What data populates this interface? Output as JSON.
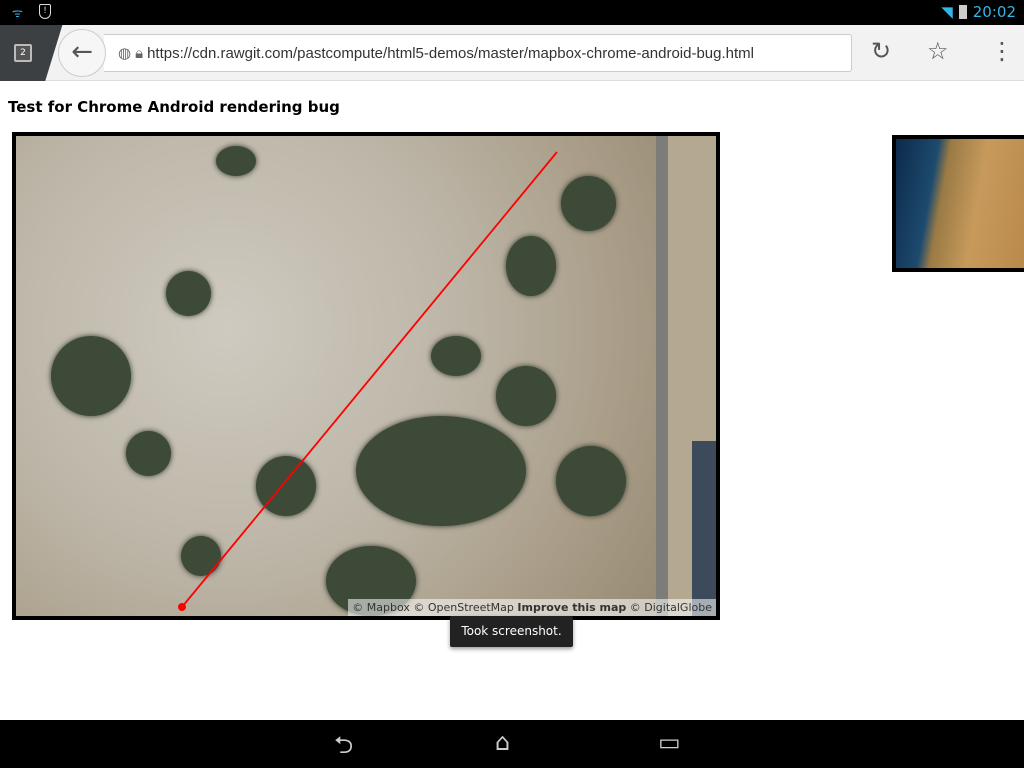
{
  "status_bar": {
    "time": "20:02",
    "icons": [
      "wifi-icon",
      "shield-alert-icon",
      "wifi-signal-icon",
      "battery-icon"
    ]
  },
  "browser": {
    "tab_count": "2",
    "url": "https://cdn.rawgit.com/pastcompute/html5-demos/master/mapbox-chrome-android-bug.html"
  },
  "page": {
    "title": "Test for Chrome Android rendering bug"
  },
  "map": {
    "attribution": {
      "mapbox": "© Mapbox",
      "osm": "© OpenStreetMap",
      "improve": "Improve this map",
      "digitalglobe": "© DigitalGlobe"
    },
    "line_color": "#ff0000"
  },
  "toast": {
    "text": "Took screenshot."
  }
}
